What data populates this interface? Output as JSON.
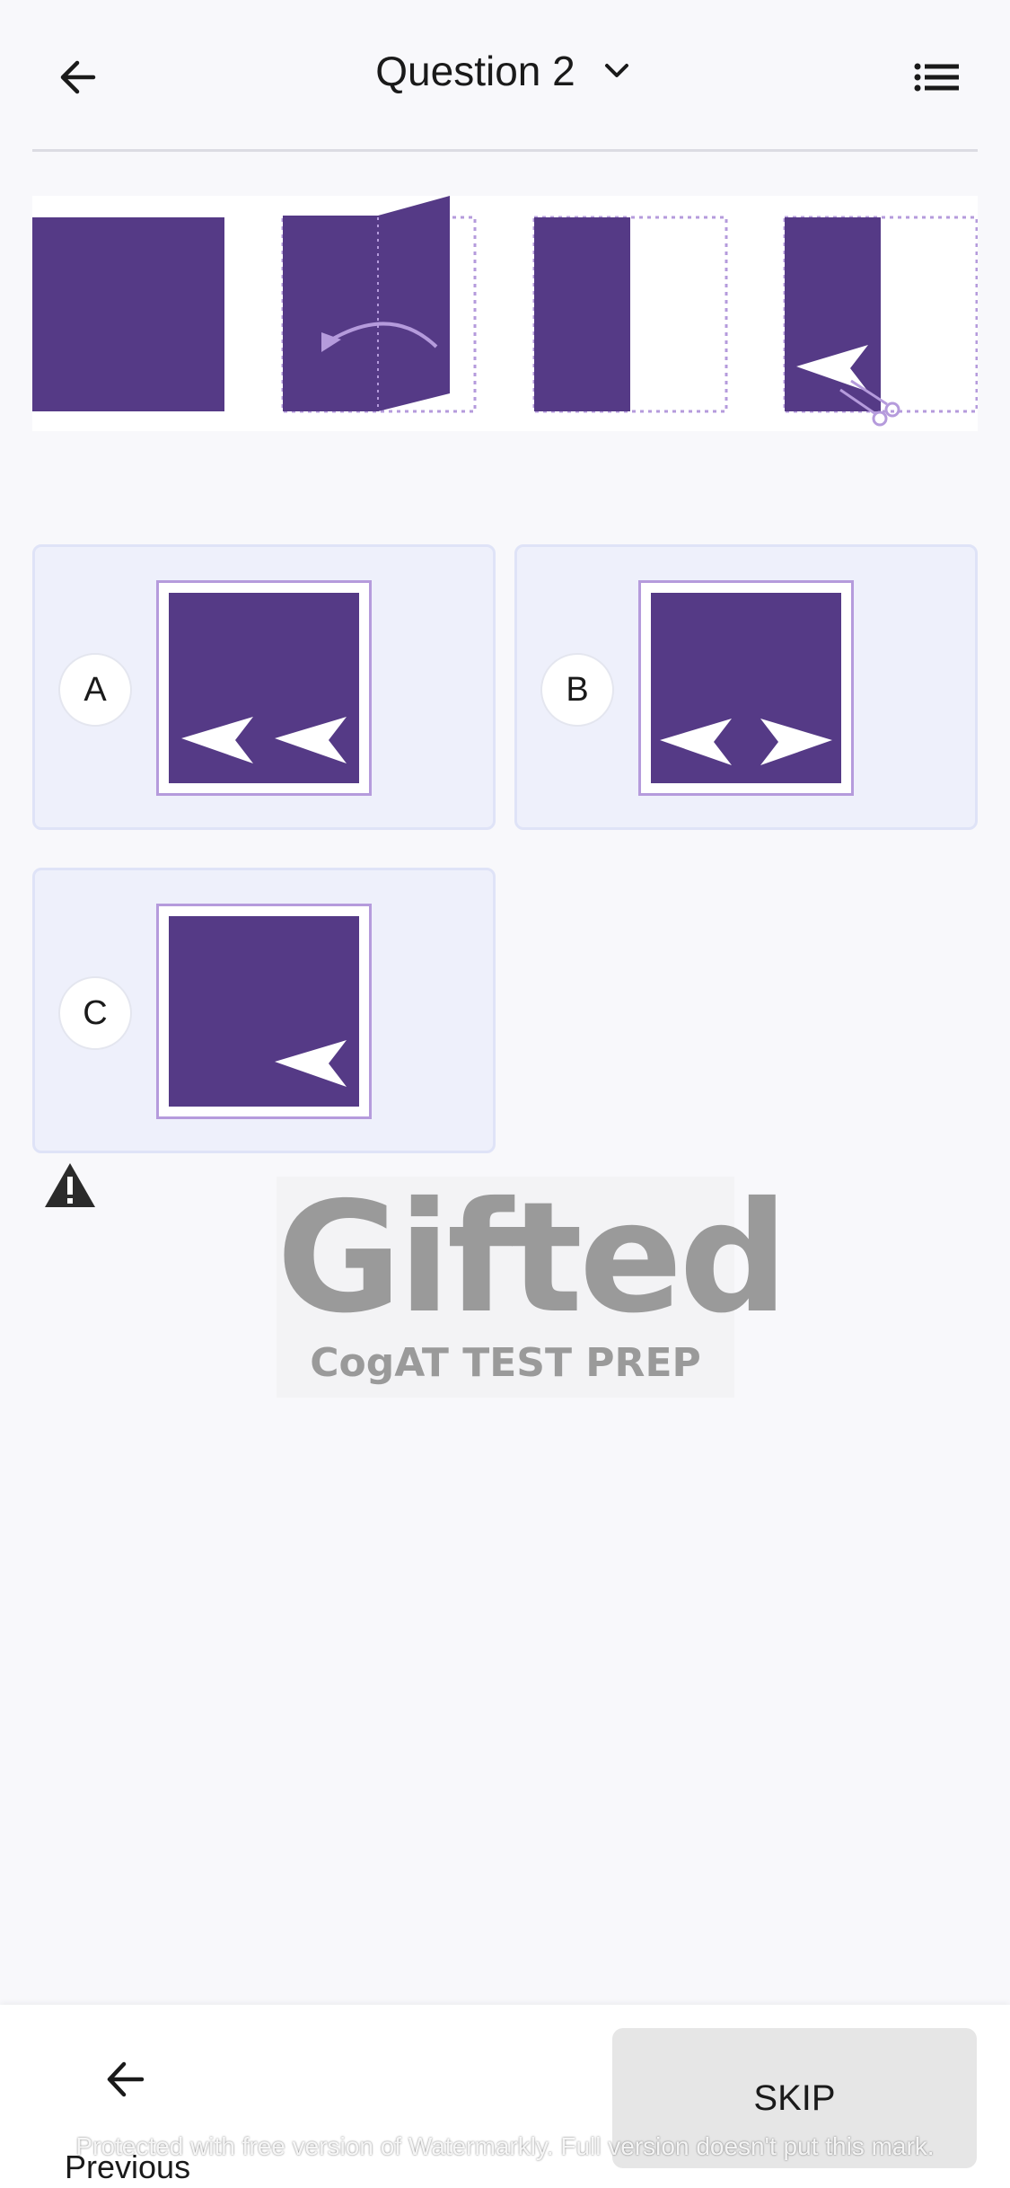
{
  "header": {
    "title": "Question 2",
    "back_icon": "arrow-left-icon",
    "dropdown_icon": "chevron-down-icon",
    "list_icon": "list-icon"
  },
  "colors": {
    "paper": "#553a86",
    "fold_line": "#b59bdc",
    "option_bg": "#eef0fb"
  },
  "options": [
    {
      "letter": "A"
    },
    {
      "letter": "B"
    },
    {
      "letter": "C"
    }
  ],
  "warning_icon": "warning-triangle-icon",
  "logo": {
    "main": "Gifted",
    "sub": "CogAT TEST PREP"
  },
  "footer": {
    "previous_label": "Previous",
    "skip_label": "SKIP",
    "watermark": "Protected with free version of Watermarkly. Full version doesn't put this mark."
  }
}
